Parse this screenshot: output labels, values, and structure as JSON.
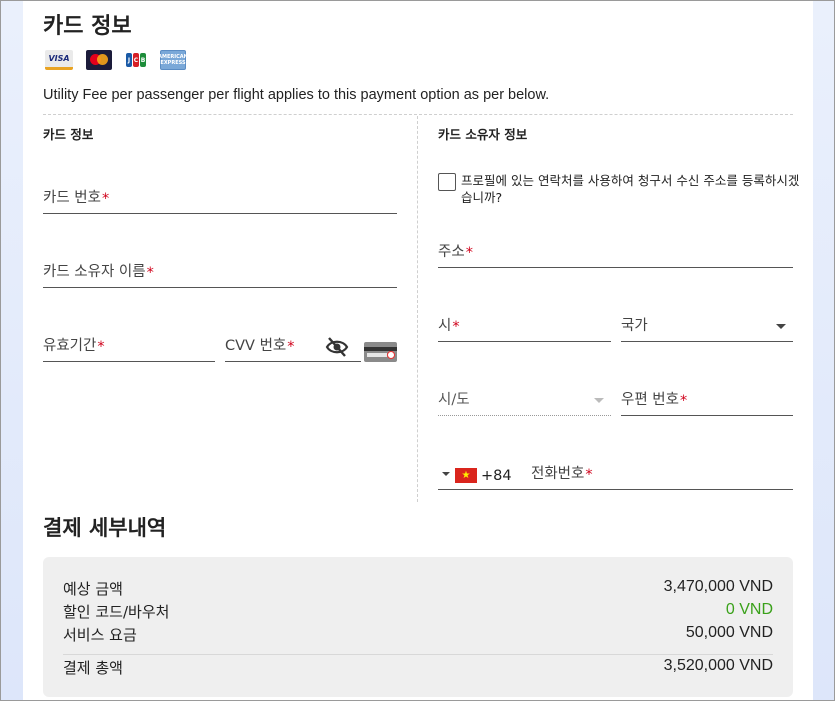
{
  "card_section": {
    "title": "카드 정보",
    "logos": [
      "VISA",
      "MasterCard",
      "JCB",
      "AMERICAN EXPRESS"
    ],
    "utility_note": "Utility Fee per passenger per flight applies to this payment option as per below."
  },
  "card_info": {
    "heading": "카드 정보",
    "card_number_label": "카드 번호",
    "cardholder_name_label": "카드 소유자 이름",
    "expiry_label": "유효기간",
    "cvv_label": "CVV 번호",
    "required_mark": "*"
  },
  "holder_info": {
    "heading": "카드 소유자 정보",
    "use_profile_checkbox_label": "프로필에 있는 연락처를 사용하여 청구서 수신 주소를 등록하시겠습니까?",
    "address_label": "주소",
    "city_label": "시",
    "country_label": "국가",
    "state_label": "시/도",
    "postal_label": "우편 번호",
    "phone_label": "전화번호",
    "dial_code": "+84",
    "flag_star": "★"
  },
  "payment_details": {
    "title": "결제 세부내역",
    "rows": [
      {
        "label": "예상 금액",
        "value": "3,470,000 VND"
      },
      {
        "label": "할인 코드/바우처",
        "value": "0 VND"
      },
      {
        "label": "서비스 요금",
        "value": "50,000 VND"
      }
    ],
    "total": {
      "label": "결제 총액",
      "value": "3,520,000 VND"
    }
  },
  "colors": {
    "required": "#d0021b",
    "discount_green": "#3aa11a",
    "summary_bg": "#efefef"
  },
  "icons": [
    "eye-slash-icon",
    "cvv-card-icon",
    "chevron-down-icon",
    "vietnam-flag-icon"
  ]
}
